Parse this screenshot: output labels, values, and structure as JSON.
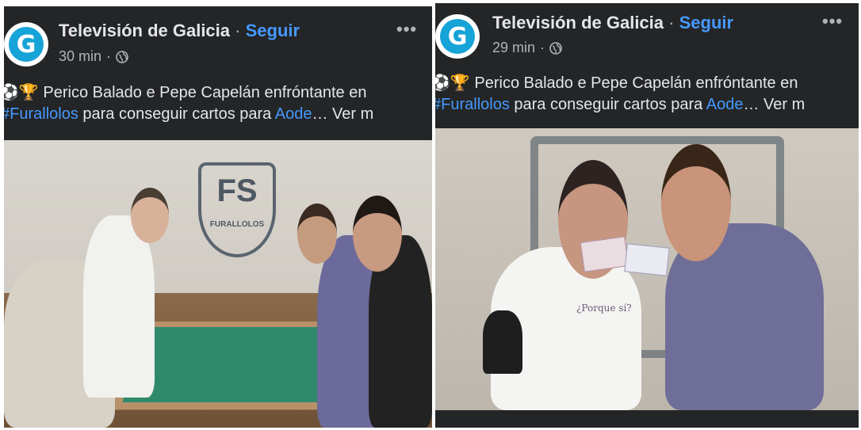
{
  "posts": [
    {
      "page_name": "Televisión de Galicia",
      "separator": "·",
      "follow_label": "Seguir",
      "time": "30 min",
      "time_separator": "·",
      "logo_letter": "G",
      "more_label": "•••",
      "caption_emoji": "⚽🏆",
      "caption_line1": "Perico Balado e Pepe Capelán enfróntante en",
      "hashtag": "#Furallolos",
      "caption_line2_mid": " para conseguir cartos para ",
      "mention": "Aode",
      "see_more": "… Ver m",
      "photo_alt": "Four people playing foosball in front of a Furallolos crest",
      "crest_text": "FS",
      "crest_subtext": "FURALLOLOS"
    },
    {
      "page_name": "Televisión de Galicia",
      "separator": "·",
      "follow_label": "Seguir",
      "time": "29 min",
      "time_separator": "·",
      "logo_letter": "G",
      "more_label": "•••",
      "caption_emoji": "⚽🏆",
      "caption_line1": "Perico Balado e Pepe Capelán enfróntante en",
      "hashtag": "#Furallolos",
      "caption_line2_mid": " para conseguir cartos para ",
      "mention": "Aode",
      "see_more": "… Ver m",
      "photo_alt": "Two people holding up banknotes and smiling",
      "shirt_text": "¿Porque sí?"
    }
  ],
  "colors": {
    "panel_bg": "#242526",
    "link_blue": "#4599ff",
    "text_primary": "#e4e6eb",
    "text_secondary": "#b0b3b8",
    "logo_blue": "#16a3d7"
  },
  "icons": {
    "globe": "globe-icon",
    "more": "more-icon"
  }
}
